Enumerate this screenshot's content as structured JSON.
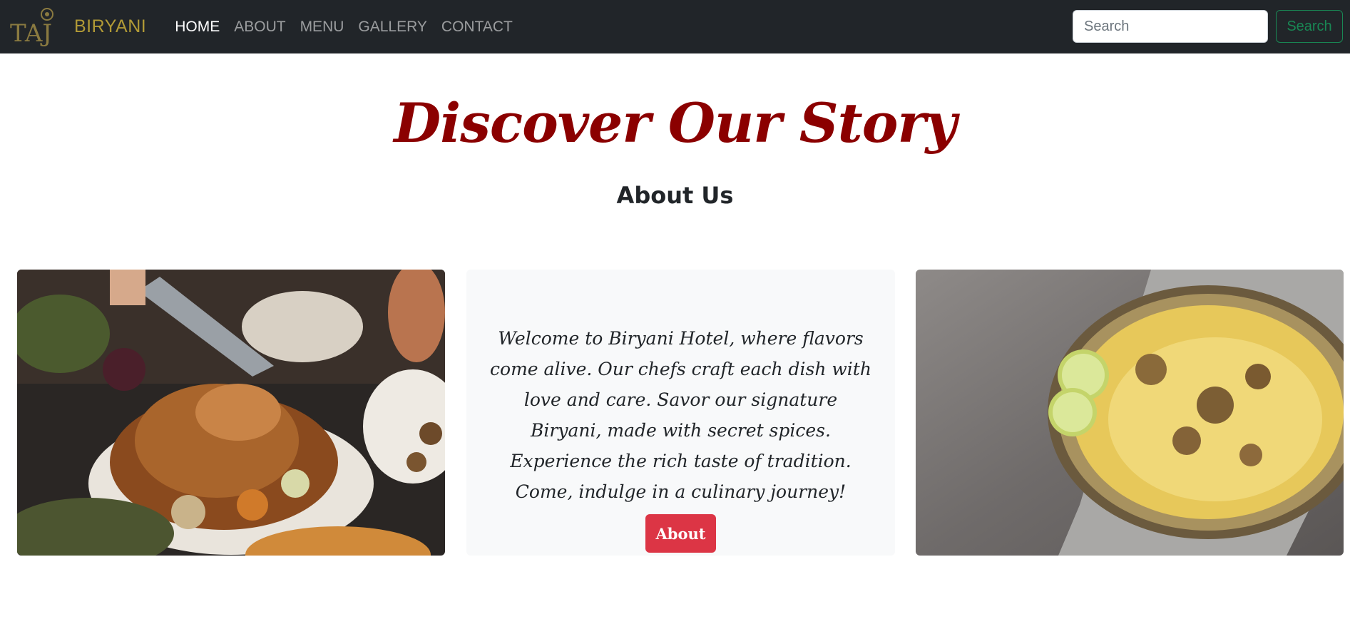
{
  "brand": {
    "logo_text": "TAJ",
    "name": "BIRYANI"
  },
  "nav": {
    "items": [
      {
        "label": "HOME",
        "active": true
      },
      {
        "label": "ABOUT",
        "active": false
      },
      {
        "label": "MENU",
        "active": false
      },
      {
        "label": "GALLERY",
        "active": false
      },
      {
        "label": "CONTACT",
        "active": false
      }
    ]
  },
  "search": {
    "placeholder": "Search",
    "button_label": "Search"
  },
  "hero": {
    "title": "Discover Our Story",
    "subtitle": "About Us"
  },
  "about_card": {
    "text": "Welcome to Biryani Hotel, where flavors come alive. Our chefs craft each dish with love and care. Savor our signature Biryani, made with secret spices. Experience the rich taste of tradition. Come, indulge in a culinary journey!",
    "button_label": "About"
  },
  "images": [
    {
      "name": "roast-chicken-photo"
    },
    {
      "name": "biryani-plate-photo"
    }
  ],
  "colors": {
    "navbar_bg": "#212529",
    "brand": "#b19a36",
    "title": "#8b0000",
    "search_button": "#198754",
    "about_button": "#dc3545",
    "card_bg": "#f8f9fa"
  }
}
